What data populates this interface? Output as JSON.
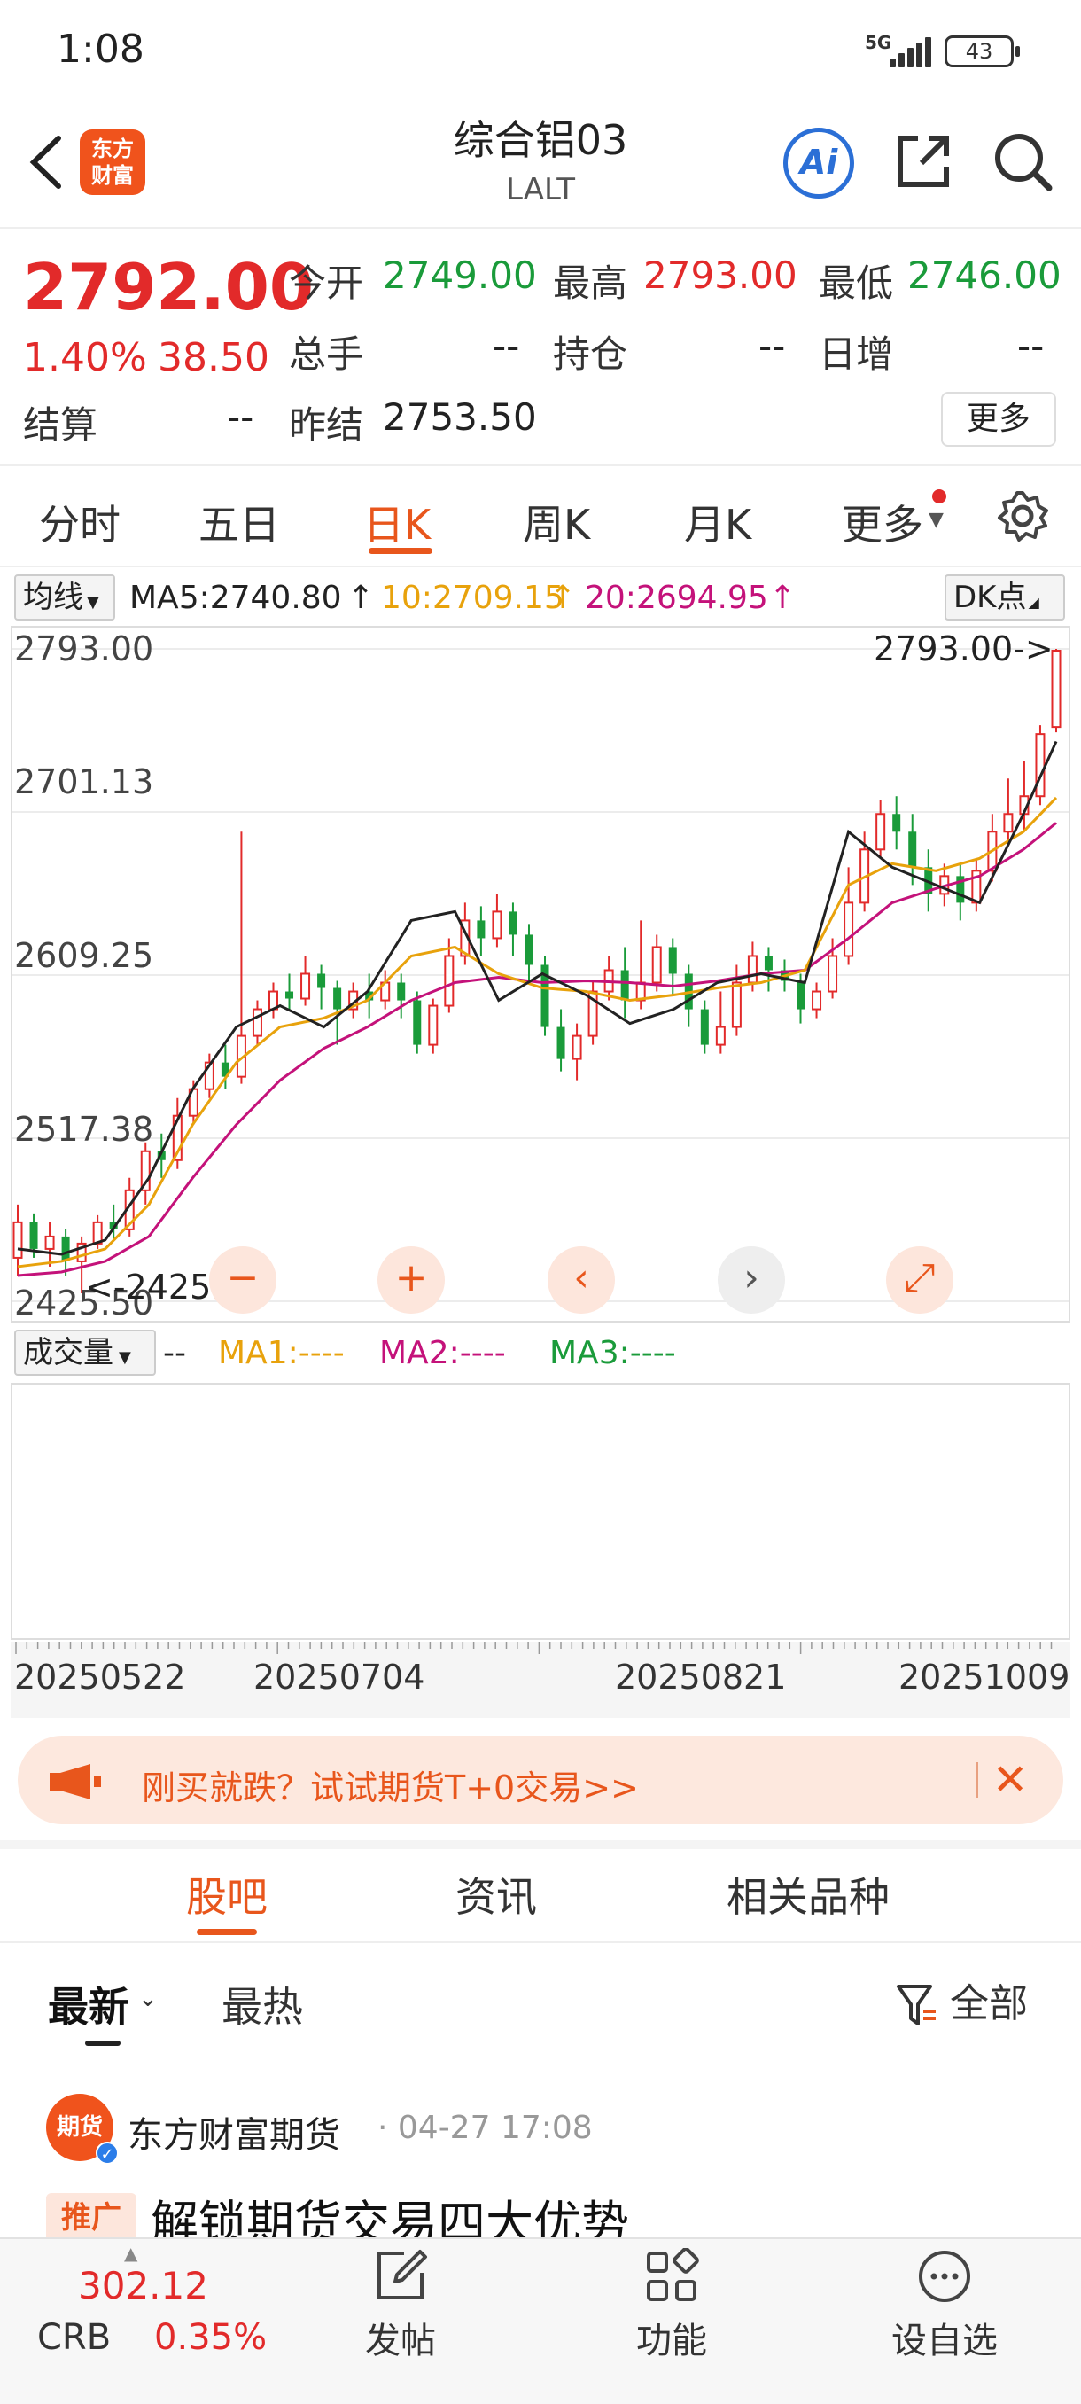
{
  "status": {
    "time": "1:08",
    "network": "5G",
    "battery": "43"
  },
  "header": {
    "logo_text": "东方财富",
    "title": "综合铝03",
    "subtitle": "LALT"
  },
  "quote": {
    "last_price": "2792.00",
    "change_pct": "1.40%",
    "change": "38.50",
    "fields": [
      {
        "label": "今开",
        "value": "2749.00",
        "color": "#1a9b3a"
      },
      {
        "label": "最高",
        "value": "2793.00",
        "color": "#e22a2a"
      },
      {
        "label": "最低",
        "value": "2746.00",
        "color": "#1a9b3a"
      },
      {
        "label": "总手",
        "value": "--",
        "color": "#222222"
      },
      {
        "label": "持仓",
        "value": "--",
        "color": "#222222"
      },
      {
        "label": "日增",
        "value": "--",
        "color": "#222222"
      },
      {
        "label": "结算",
        "value": "--",
        "color": "#222222"
      },
      {
        "label": "昨结",
        "value": "2753.50",
        "color": "#222222"
      }
    ],
    "more_button": "更多"
  },
  "period_tabs": [
    "分时",
    "五日",
    "日K",
    "周K",
    "月K",
    "更多"
  ],
  "active_period": "日K",
  "ma_bar": {
    "selector": "均线",
    "ma5": "MA5:2740.80",
    "ma10": "10:2709.15",
    "ma20": "20:2694.95",
    "dk": "DK点",
    "colors": {
      "ma5": "#222222",
      "ma10": "#e8a20c",
      "ma20": "#c4127a"
    }
  },
  "chart_data": {
    "type": "candlestick",
    "y_ticks": [
      "2793.00",
      "2701.13",
      "2609.25",
      "2517.38",
      "2425.50"
    ],
    "ylim": [
      2425.5,
      2793.0
    ],
    "annotations": {
      "high": "2793.00->",
      "low": "<-2425.50"
    },
    "series_points": {
      "ma5": [
        [
          0,
          2455
        ],
        [
          4,
          2452
        ],
        [
          8,
          2460
        ],
        [
          12,
          2495
        ],
        [
          16,
          2545
        ],
        [
          20,
          2580
        ],
        [
          24,
          2592
        ],
        [
          28,
          2580
        ],
        [
          32,
          2600
        ],
        [
          36,
          2640
        ],
        [
          40,
          2645
        ],
        [
          44,
          2595
        ],
        [
          48,
          2610
        ],
        [
          52,
          2598
        ],
        [
          56,
          2582
        ],
        [
          60,
          2590
        ],
        [
          64,
          2605
        ],
        [
          68,
          2610
        ],
        [
          72,
          2605
        ],
        [
          76,
          2690
        ],
        [
          80,
          2670
        ],
        [
          84,
          2660
        ],
        [
          88,
          2650
        ],
        [
          92,
          2700
        ],
        [
          95,
          2740.8
        ]
      ],
      "ma10": [
        [
          0,
          2445
        ],
        [
          4,
          2448
        ],
        [
          8,
          2455
        ],
        [
          12,
          2480
        ],
        [
          16,
          2525
        ],
        [
          20,
          2560
        ],
        [
          24,
          2580
        ],
        [
          28,
          2585
        ],
        [
          32,
          2595
        ],
        [
          36,
          2620
        ],
        [
          40,
          2625
        ],
        [
          44,
          2610
        ],
        [
          48,
          2602
        ],
        [
          52,
          2600
        ],
        [
          56,
          2595
        ],
        [
          60,
          2598
        ],
        [
          64,
          2602
        ],
        [
          68,
          2605
        ],
        [
          72,
          2612
        ],
        [
          76,
          2660
        ],
        [
          80,
          2672
        ],
        [
          84,
          2668
        ],
        [
          88,
          2675
        ],
        [
          92,
          2690
        ],
        [
          95,
          2709.15
        ]
      ],
      "ma20": [
        [
          0,
          2440
        ],
        [
          4,
          2442
        ],
        [
          8,
          2448
        ],
        [
          12,
          2462
        ],
        [
          16,
          2495
        ],
        [
          20,
          2525
        ],
        [
          24,
          2550
        ],
        [
          28,
          2568
        ],
        [
          32,
          2580
        ],
        [
          36,
          2595
        ],
        [
          40,
          2605
        ],
        [
          44,
          2608
        ],
        [
          48,
          2605
        ],
        [
          52,
          2606
        ],
        [
          56,
          2605
        ],
        [
          60,
          2603
        ],
        [
          64,
          2606
        ],
        [
          68,
          2610
        ],
        [
          72,
          2612
        ],
        [
          76,
          2630
        ],
        [
          80,
          2650
        ],
        [
          84,
          2658
        ],
        [
          88,
          2665
        ],
        [
          92,
          2680
        ],
        [
          95,
          2694.95
        ]
      ]
    },
    "candles": [
      [
        2450,
        2470,
        2440,
        2480
      ],
      [
        2470,
        2455,
        2450,
        2475
      ],
      [
        2455,
        2462,
        2445,
        2470
      ],
      [
        2462,
        2448,
        2440,
        2466
      ],
      [
        2448,
        2458,
        2430,
        2462
      ],
      [
        2458,
        2470,
        2455,
        2474
      ],
      [
        2470,
        2466,
        2460,
        2480
      ],
      [
        2466,
        2488,
        2462,
        2495
      ],
      [
        2488,
        2510,
        2480,
        2515
      ],
      [
        2510,
        2505,
        2495,
        2520
      ],
      [
        2505,
        2530,
        2500,
        2540
      ],
      [
        2530,
        2545,
        2525,
        2550
      ],
      [
        2545,
        2560,
        2540,
        2565
      ],
      [
        2560,
        2552,
        2545,
        2570
      ],
      [
        2552,
        2575,
        2548,
        2690
      ],
      [
        2575,
        2590,
        2570,
        2595
      ],
      [
        2590,
        2600,
        2585,
        2605
      ],
      [
        2600,
        2596,
        2590,
        2610
      ],
      [
        2596,
        2610,
        2592,
        2620
      ],
      [
        2610,
        2602,
        2590,
        2615
      ],
      [
        2602,
        2590,
        2570,
        2606
      ],
      [
        2590,
        2600,
        2585,
        2605
      ],
      [
        2600,
        2595,
        2585,
        2610
      ],
      [
        2595,
        2605,
        2590,
        2612
      ],
      [
        2605,
        2595,
        2585,
        2610
      ],
      [
        2595,
        2570,
        2565,
        2600
      ],
      [
        2570,
        2592,
        2565,
        2596
      ],
      [
        2592,
        2620,
        2588,
        2630
      ],
      [
        2620,
        2640,
        2615,
        2650
      ],
      [
        2640,
        2630,
        2620,
        2648
      ],
      [
        2630,
        2645,
        2625,
        2655
      ],
      [
        2645,
        2632,
        2620,
        2650
      ],
      [
        2632,
        2615,
        2605,
        2638
      ],
      [
        2615,
        2580,
        2575,
        2620
      ],
      [
        2580,
        2562,
        2555,
        2590
      ],
      [
        2562,
        2575,
        2550,
        2582
      ],
      [
        2575,
        2600,
        2570,
        2606
      ],
      [
        2600,
        2612,
        2595,
        2620
      ],
      [
        2612,
        2595,
        2585,
        2625
      ],
      [
        2595,
        2605,
        2590,
        2640
      ],
      [
        2605,
        2625,
        2600,
        2632
      ],
      [
        2625,
        2610,
        2598,
        2630
      ],
      [
        2610,
        2590,
        2580,
        2615
      ],
      [
        2590,
        2570,
        2565,
        2595
      ],
      [
        2570,
        2580,
        2565,
        2600
      ],
      [
        2580,
        2605,
        2575,
        2615
      ],
      [
        2605,
        2620,
        2600,
        2628
      ],
      [
        2620,
        2612,
        2600,
        2625
      ],
      [
        2612,
        2606,
        2600,
        2618
      ],
      [
        2606,
        2590,
        2582,
        2610
      ],
      [
        2590,
        2600,
        2585,
        2605
      ],
      [
        2600,
        2620,
        2596,
        2630
      ],
      [
        2620,
        2650,
        2615,
        2670
      ],
      [
        2650,
        2680,
        2645,
        2690
      ],
      [
        2680,
        2700,
        2675,
        2708
      ],
      [
        2700,
        2690,
        2680,
        2710
      ],
      [
        2690,
        2670,
        2660,
        2700
      ],
      [
        2670,
        2655,
        2645,
        2680
      ],
      [
        2655,
        2665,
        2648,
        2672
      ],
      [
        2665,
        2650,
        2640,
        2672
      ],
      [
        2650,
        2668,
        2645,
        2675
      ],
      [
        2668,
        2690,
        2662,
        2700
      ],
      [
        2690,
        2700,
        2685,
        2720
      ],
      [
        2700,
        2710,
        2690,
        2730
      ],
      [
        2710,
        2745,
        2705,
        2750
      ],
      [
        2749,
        2792,
        2746,
        2793
      ]
    ],
    "volume_selector": "成交量",
    "volume_legend": {
      "dash": "--",
      "ma1": "MA1:----",
      "ma2": "MA2:----",
      "ma3": "MA3:----"
    },
    "x_ticks": [
      "20250522",
      "20250704",
      "20250821",
      "20251009"
    ]
  },
  "controls": {
    "minus": "−",
    "plus": "+",
    "left": "‹",
    "right": "›",
    "expand": "⤢"
  },
  "banner": {
    "text": "刚买就跌？试试期货T+0交易>>",
    "close": "✕"
  },
  "section_tabs": [
    "股吧",
    "资讯",
    "相关品种"
  ],
  "feed_filter": {
    "latest": "最新",
    "hot": "最热",
    "all": "全部"
  },
  "post": {
    "avatar_text": "期货",
    "author": "东方财富期货",
    "time": "· 04-27 17:08",
    "tag": "推广",
    "title": "解锁期货交易四大优势"
  },
  "bottom": {
    "crb_value": "302.12",
    "crb_name": "CRB",
    "crb_pct": "0.35%",
    "nav": [
      "发帖",
      "功能",
      "设自选"
    ]
  }
}
